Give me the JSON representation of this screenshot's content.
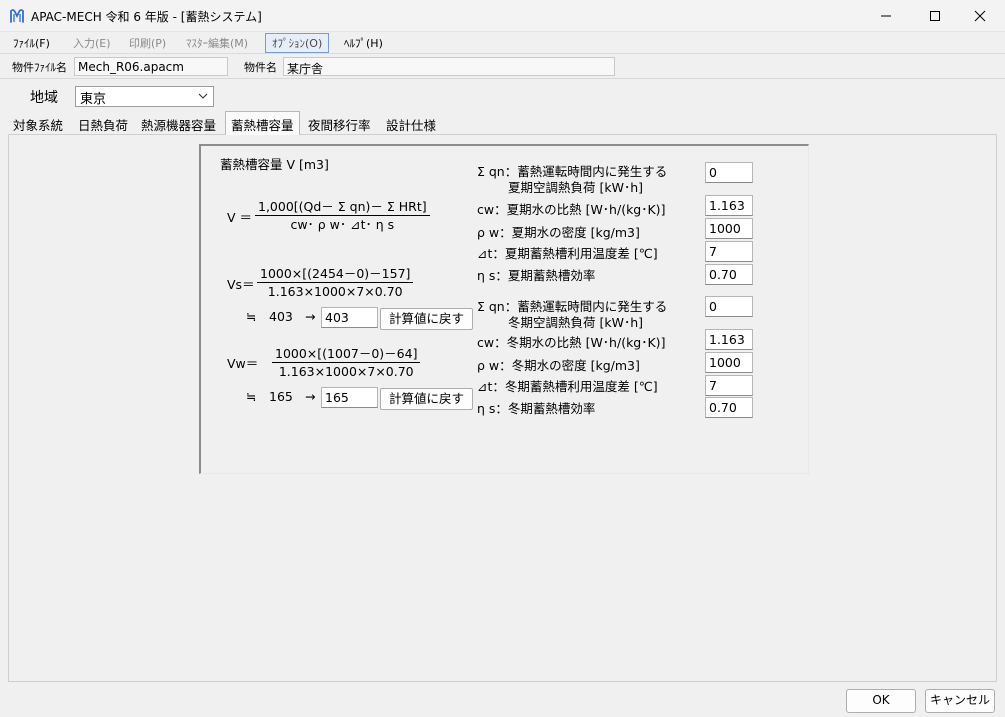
{
  "window": {
    "title": "APAC-MECH 令和 6 年版 - [蓄熱システム]",
    "app_icon": "apac-m-logo-icon",
    "controls": [
      "minimize-icon",
      "maximize-icon",
      "close-icon"
    ]
  },
  "menu": {
    "items": [
      {
        "label": "ﾌｧｲﾙ(F)",
        "state": "enabled"
      },
      {
        "label": "入力(E)",
        "state": "disabled"
      },
      {
        "label": "印刷(P)",
        "state": "disabled"
      },
      {
        "label": "ﾏｽﾀｰ編集(M)",
        "state": "disabled"
      },
      {
        "label": "ｵﾌﾟｼｮﾝ(O)",
        "state": "selected"
      },
      {
        "label": "ﾍﾙﾌﾟ(H)",
        "state": "enabled"
      }
    ]
  },
  "property": {
    "file_label": "物件ﾌｧｲﾙ名",
    "file_value": "Mech_R06.apacm",
    "name_label": "物件名",
    "name_value": "某庁舎"
  },
  "region": {
    "label": "地域",
    "value": "東京"
  },
  "tabs": [
    {
      "label": "対象系統",
      "active": false
    },
    {
      "label": "日熱負荷",
      "active": false
    },
    {
      "label": "熱源機器容量",
      "active": false
    },
    {
      "label": "蓄熱槽容量",
      "active": true
    },
    {
      "label": "夜間移行率",
      "active": false
    },
    {
      "label": "設計仕様",
      "active": false
    }
  ],
  "panel": {
    "heading": "蓄熱槽容量 V [m3]",
    "formula": {
      "lhs": "V ＝",
      "numerator": "1,000[(Qd－ Σ qn)－ Σ HRt]",
      "denominator": "cw･ ρ w･ ⊿t･ η s"
    },
    "summer": {
      "lhs": "Vs＝",
      "numerator": "1000×[(2454－0)－157]",
      "denominator": "1.163×1000×7×0.70",
      "approx_symbol": "≒",
      "approx_value": "403",
      "arrow": "→",
      "input_value": "403",
      "reset_label": "計算値に戻す"
    },
    "winter": {
      "lhs": "Vw＝",
      "numerator": "1000×[(1007－0)－64]",
      "denominator": "1.163×1000×7×0.70",
      "approx_symbol": "≒",
      "approx_value": "165",
      "arrow": "→",
      "input_value": "165",
      "reset_label": "計算値に戻す"
    },
    "summer_params": [
      {
        "label": "Σ qn：蓄熱運転時間内に発生する",
        "label2": "夏期空調熱負荷 [kW･h]",
        "value": "0"
      },
      {
        "label": "cw：夏期水の比熱 [W･h/(kg･K)]",
        "value": "1.163"
      },
      {
        "label": "ρ w：夏期水の密度 [kg/m3]",
        "value": "1000"
      },
      {
        "label": "⊿t：夏期蓄熱槽利用温度差 [℃]",
        "value": "7"
      },
      {
        "label": "η s：夏期蓄熱槽効率",
        "value": "0.70"
      }
    ],
    "winter_params": [
      {
        "label": "Σ qn：蓄熱運転時間内に発生する",
        "label2": "冬期空調熱負荷 [kW･h]",
        "value": "0"
      },
      {
        "label": "cw：冬期水の比熱 [W･h/(kg･K)]",
        "value": "1.163"
      },
      {
        "label": "ρ w：冬期水の密度 [kg/m3]",
        "value": "1000"
      },
      {
        "label": "⊿t：冬期蓄熱槽利用温度差 [℃]",
        "value": "7"
      },
      {
        "label": "η s：冬期蓄熱槽効率",
        "value": "0.70"
      }
    ]
  },
  "footer": {
    "ok_label": "OK",
    "cancel_label": "キャンセル"
  }
}
